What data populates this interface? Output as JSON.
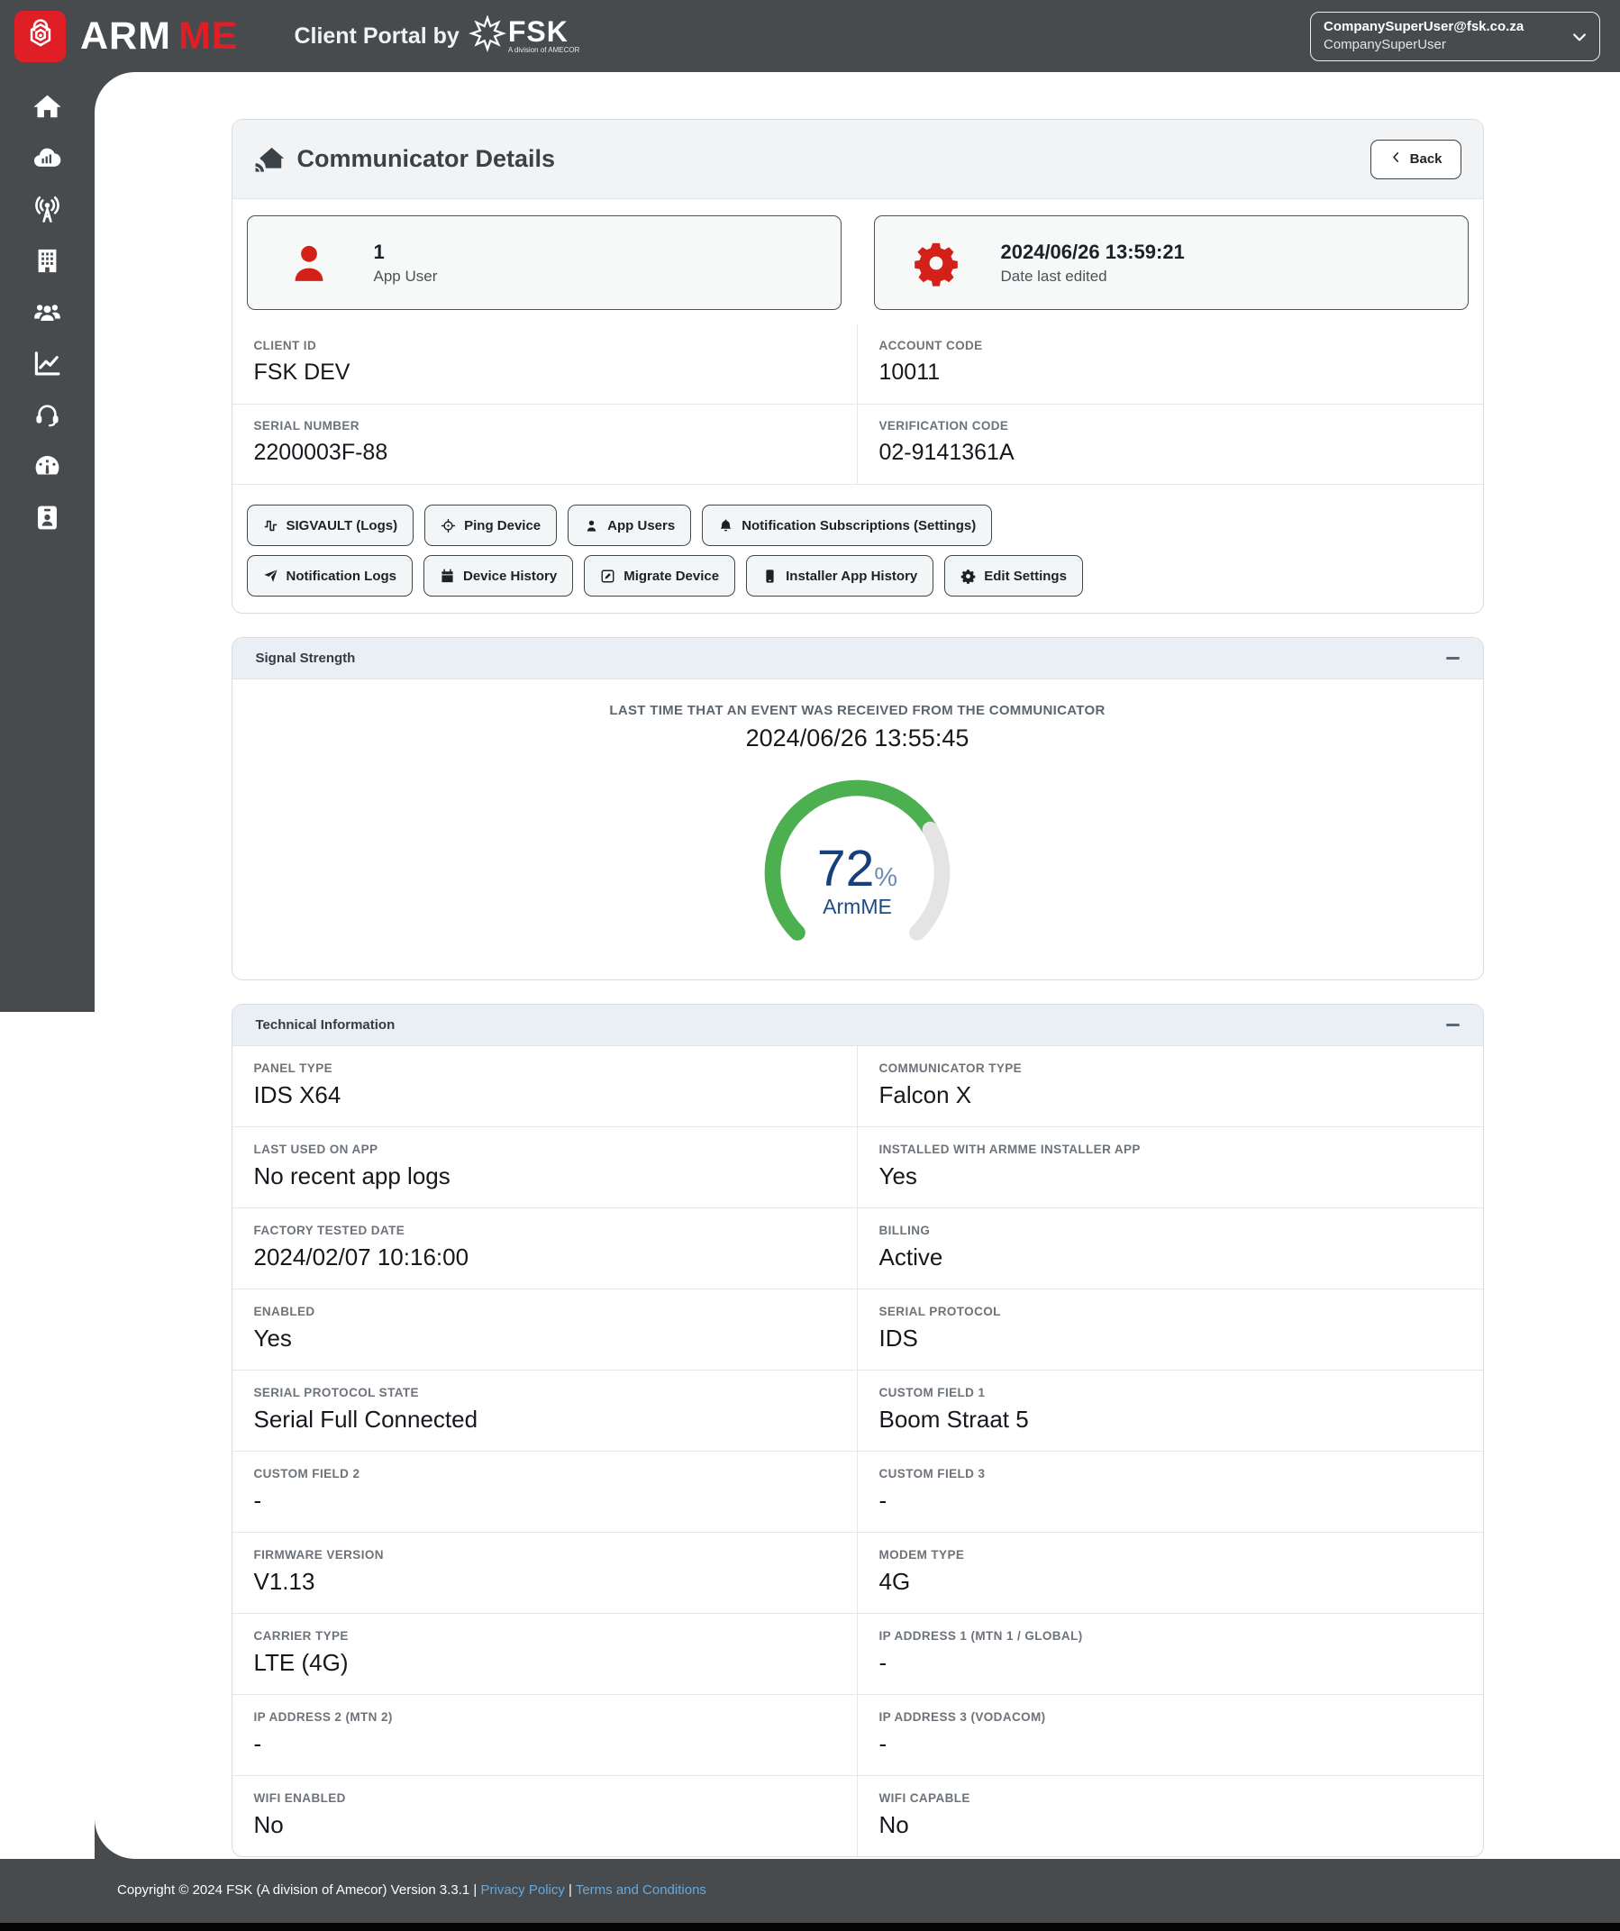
{
  "header": {
    "brand": {
      "arm": "ARM",
      "me": "ME"
    },
    "subtitle": "Client Portal by",
    "fsk": {
      "name": "FSK",
      "division": "A division of AMECOR"
    },
    "user": {
      "email": "CompanySuperUser@fsk.co.za",
      "name": "CompanySuperUser"
    }
  },
  "sidebar": {
    "items": [
      {
        "name": "home",
        "icon": "home"
      },
      {
        "name": "cloud-stats",
        "icon": "cloudbars"
      },
      {
        "name": "broadcast-tower",
        "icon": "tower"
      },
      {
        "name": "buildings",
        "icon": "building"
      },
      {
        "name": "users",
        "icon": "users"
      },
      {
        "name": "reports",
        "icon": "chart"
      },
      {
        "name": "support",
        "icon": "headset"
      },
      {
        "name": "dashboard",
        "icon": "gaugeicon"
      },
      {
        "name": "contacts",
        "icon": "idcard"
      }
    ]
  },
  "page": {
    "title": "Communicator Details",
    "back_label": "Back",
    "stats": [
      {
        "icon": "person",
        "value": "1",
        "label": "App User"
      },
      {
        "icon": "gear",
        "value": "2024/06/26 13:59:21",
        "label": "Date last edited"
      }
    ],
    "fields": [
      {
        "label": "CLIENT ID",
        "value": "FSK DEV"
      },
      {
        "label": "ACCOUNT CODE",
        "value": "10011"
      },
      {
        "label": "SERIAL NUMBER",
        "value": "2200003F-88"
      },
      {
        "label": "VERIFICATION CODE",
        "value": "02-9141361A"
      }
    ],
    "actions": [
      [
        {
          "icon": "wave",
          "label": "SIGVAULT (Logs)"
        },
        {
          "icon": "ping",
          "label": "Ping Device"
        },
        {
          "icon": "usersm",
          "label": "App Users"
        },
        {
          "icon": "bell",
          "label": "Notification Subscriptions (Settings)"
        }
      ],
      [
        {
          "icon": "send",
          "label": "Notification Logs"
        },
        {
          "icon": "calendar",
          "label": "Device History"
        },
        {
          "icon": "pensquare",
          "label": "Migrate Device"
        },
        {
          "icon": "mobile",
          "label": "Installer App History"
        },
        {
          "icon": "gearsm",
          "label": "Edit Settings"
        }
      ]
    ]
  },
  "signal": {
    "section_title": "Signal Strength",
    "last_event_label": "LAST TIME THAT AN EVENT WAS RECEIVED FROM THE COMMUNICATOR",
    "last_event_time": "2024/06/26 13:55:45",
    "gauge": {
      "percent": 72,
      "unit": "%",
      "label": "ArmME",
      "color": "#4caf50",
      "track": "#e4e4e4"
    }
  },
  "technical": {
    "section_title": "Technical Information",
    "fields": [
      {
        "label": "PANEL TYPE",
        "value": "IDS X64"
      },
      {
        "label": "COMMUNICATOR TYPE",
        "value": "Falcon X"
      },
      {
        "label": "LAST USED ON APP",
        "value": "No recent app logs"
      },
      {
        "label": "INSTALLED WITH ARMME INSTALLER APP",
        "value": "Yes"
      },
      {
        "label": "FACTORY TESTED DATE",
        "value": "2024/02/07 10:16:00"
      },
      {
        "label": "BILLING",
        "value": "Active"
      },
      {
        "label": "ENABLED",
        "value": "Yes"
      },
      {
        "label": "SERIAL PROTOCOL",
        "value": "IDS"
      },
      {
        "label": "SERIAL PROTOCOL STATE",
        "value": "Serial Full Connected"
      },
      {
        "label": "CUSTOM FIELD 1",
        "value": "Boom Straat 5"
      },
      {
        "label": "CUSTOM FIELD 2",
        "value": "-"
      },
      {
        "label": "CUSTOM FIELD 3",
        "value": "-"
      },
      {
        "label": "FIRMWARE VERSION",
        "value": "V1.13"
      },
      {
        "label": "MODEM TYPE",
        "value": "4G"
      },
      {
        "label": "CARRIER TYPE",
        "value": "LTE (4G)"
      },
      {
        "label": "IP ADDRESS 1 (MTN 1 / GLOBAL)",
        "value": "-"
      },
      {
        "label": "IP ADDRESS 2 (MTN 2)",
        "value": "-"
      },
      {
        "label": "IP ADDRESS 3 (VODACOM)",
        "value": "-"
      },
      {
        "label": "WIFI ENABLED",
        "value": "No"
      },
      {
        "label": "WIFI CAPABLE",
        "value": "No"
      }
    ]
  },
  "footer": {
    "copyright": "Copyright © 2024 FSK (A division of Amecor) Version 3.3.1",
    "divider": "|",
    "privacy": "Privacy Policy",
    "terms": "Terms and Conditions"
  }
}
